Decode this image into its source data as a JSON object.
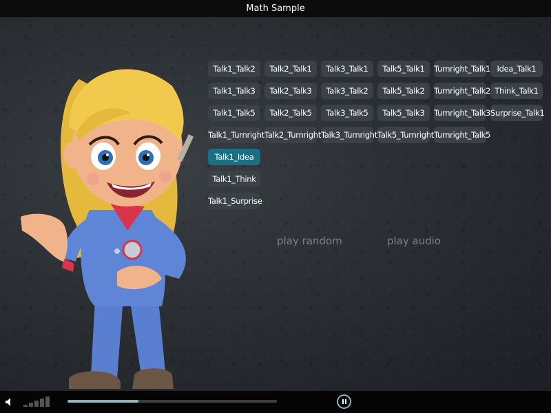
{
  "window": {
    "title": "Math Sample"
  },
  "buttons": {
    "talk1_talk2": "Talk1_Talk2",
    "talk2_talk1": "Talk2_Talk1",
    "talk3_talk1": "Talk3_Talk1",
    "talk5_talk1": "Talk5_Talk1",
    "turnright_talk1": "Turnright_Talk1",
    "idea_talk1": "Idea_Talk1",
    "talk1_talk3": "Talk1_Talk3",
    "talk2_talk3": "Talk2_Talk3",
    "talk3_talk2": "Talk3_Talk2",
    "talk5_talk2": "Talk5_Talk2",
    "turnright_talk2": "Turnright_Talk2",
    "think_talk1": "Think_Talk1",
    "talk1_talk5": "Talk1_Talk5",
    "talk2_talk5": "Talk2_Talk5",
    "talk3_talk5": "Talk3_Talk5",
    "talk5_talk3": "Talk5_Talk3",
    "turnright_talk3": "Turnright_Talk3",
    "surprise_talk1": "Surprise_Talk1",
    "talk1_turnright": "Talk1_Turnright",
    "talk2_turnright": "Talk2_Turnright",
    "talk3_turnright": "Talk3_Turnright",
    "talk5_turnright": "Talk5_Turnright",
    "turnright_talk5": "Turnright_Talk5",
    "talk1_idea": "Talk1_Idea",
    "talk1_think": "Talk1_Think",
    "talk1_surprise": "Talk1_Surprise"
  },
  "active_button": "Talk1_Idea",
  "links": {
    "play_random": "play random",
    "play_audio": "play audio"
  },
  "player": {
    "progress_fraction": 0.34,
    "state": "playing"
  },
  "colors": {
    "button_bg": "#3c4148",
    "button_active": "#1a6f85",
    "accent": "#8fb3b8"
  },
  "icons": {
    "volume": "speaker-icon",
    "pause": "pause-icon"
  }
}
